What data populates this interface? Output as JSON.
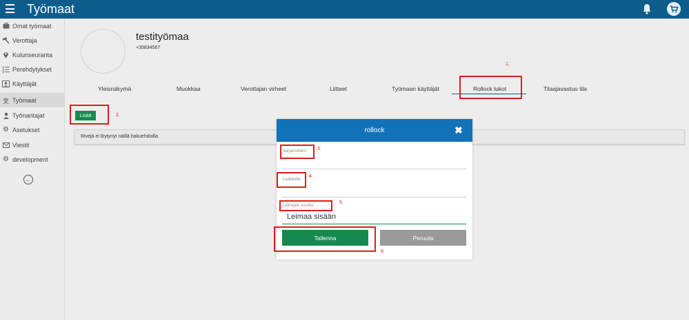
{
  "header": {
    "title": "Työmaat",
    "bell_icon": "bell-icon",
    "cart_icon": "cart-icon",
    "menu_icon": "hamburger-icon"
  },
  "sidebar": {
    "items": [
      {
        "label": "Omat työmaat",
        "icon": "briefcase-icon"
      },
      {
        "label": "Verottaja",
        "icon": "hammer-icon"
      },
      {
        "label": "Kulunseuranta",
        "icon": "map-pin-icon"
      },
      {
        "label": "Perehdytykset",
        "icon": "checklist-icon"
      },
      {
        "label": "Käyttäjät",
        "icon": "user-card-icon"
      },
      {
        "label": "Työmaat",
        "icon": "worker-icon"
      },
      {
        "label": "Työnantajat",
        "icon": "person-icon"
      },
      {
        "label": "Asetukset",
        "icon": "gear-icon"
      },
      {
        "label": "Viestit",
        "icon": "envelope-icon"
      },
      {
        "label": "development",
        "icon": "gear-icon"
      }
    ],
    "active_index": 5,
    "back_icon": "arrow-left-circle-icon"
  },
  "site": {
    "name": "testityömaa",
    "phone": "+35834567"
  },
  "tabs": [
    {
      "label": "Yleisnäkymä"
    },
    {
      "label": "Muokkaa"
    },
    {
      "label": "Verottajan virheet"
    },
    {
      "label": "Liitteet"
    },
    {
      "label": "Työmaan käyttäjät"
    },
    {
      "label": "Rollock lukot"
    },
    {
      "label": "Tilaajavastuu tila"
    }
  ],
  "active_tab": "Rollock lukot",
  "add_button": "Lisää",
  "empty_message": "Rivejä ei löytynyt näillä hakuehdoilla",
  "modal": {
    "title": "rollock",
    "fields": {
      "serial": {
        "label": "Sarjanumero"
      },
      "details": {
        "label": "Lisätiedot"
      },
      "direction": {
        "label": "Leimojen suunta",
        "value": "Leimaa sisään"
      }
    },
    "save_label": "Tallenna",
    "cancel_label": "Peruuta"
  },
  "annotations": [
    "1.",
    "2.",
    "3.",
    "4.",
    "5.",
    "6."
  ],
  "colors": {
    "topbar": "#0e5c8c",
    "modal_header": "#1272b8",
    "primary_button": "#168a4e",
    "annotation": "#e31b1b"
  }
}
